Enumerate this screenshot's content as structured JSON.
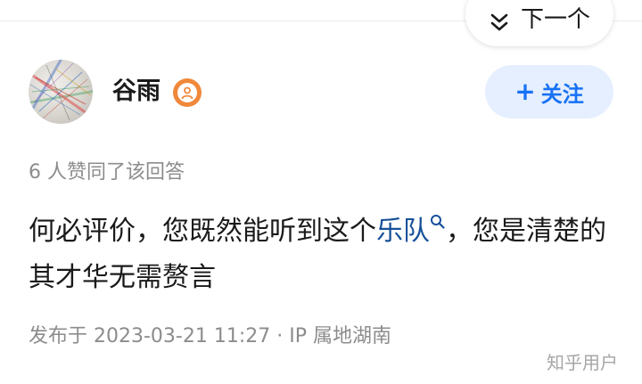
{
  "nav": {
    "next_label": "下一个",
    "next_icon": "double-chevron-down-icon"
  },
  "author": {
    "name": "谷雨",
    "badge_icon": "user-badge-icon",
    "badge_color": "#f0883a"
  },
  "follow": {
    "label": "关注",
    "plus": "+"
  },
  "answer": {
    "likes_text": "6 人赞同了该回答",
    "text_before": "何必评价，您既然能听到这个",
    "link_text": "乐队",
    "text_after": "，您是清楚的其才华无需赘言"
  },
  "meta": {
    "text": "发布于 2023-03-21 11:27 · IP 属地湖南"
  },
  "watermark": "知乎用户",
  "colors": {
    "accent": "#1772f6",
    "follow_bg": "#e5efff",
    "link": "#175199",
    "muted": "#8c8c8c"
  }
}
